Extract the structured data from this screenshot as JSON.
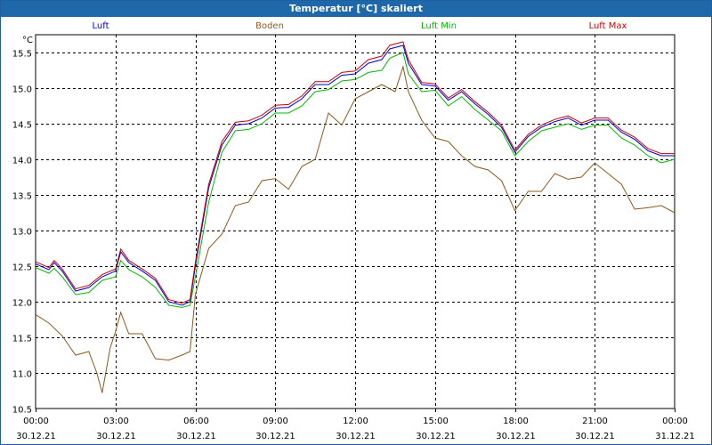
{
  "window": {
    "title": "Temperatur [°C] skaliert"
  },
  "chart_data": {
    "type": "line",
    "title": "Temperatur [°C] skaliert",
    "ylabel": "°C",
    "ylim": [
      10.5,
      15.75
    ],
    "yticks": [
      10.5,
      11.0,
      11.5,
      12.0,
      12.5,
      13.0,
      13.5,
      14.0,
      14.5,
      15.0,
      15.5
    ],
    "xlim": [
      0,
      24
    ],
    "xticks": [
      {
        "time": "00:00",
        "date": "30.12.21"
      },
      {
        "time": "03:00",
        "date": "30.12.21"
      },
      {
        "time": "06:00",
        "date": "30.12.21"
      },
      {
        "time": "09:00",
        "date": "30.12.21"
      },
      {
        "time": "12:00",
        "date": "30.12.21"
      },
      {
        "time": "15:00",
        "date": "30.12.21"
      },
      {
        "time": "18:00",
        "date": "30.12.21"
      },
      {
        "time": "21:00",
        "date": "30.12.21"
      },
      {
        "time": "00:00",
        "date": "31.12.21"
      }
    ],
    "grid": true,
    "legend_position": "top",
    "series": [
      {
        "name": "Luft",
        "color": "#0000cc",
        "x": [
          0,
          0.5,
          0.7,
          1,
          1.5,
          2,
          2.5,
          3,
          3.2,
          3.5,
          4,
          4.5,
          5,
          5.5,
          5.8,
          6,
          6.5,
          7,
          7.5,
          8,
          8.5,
          9,
          9.5,
          10,
          10.5,
          11,
          11.5,
          12,
          12.5,
          13,
          13.3,
          13.8,
          14,
          14.5,
          15,
          15.5,
          16,
          16.5,
          17,
          17.5,
          18,
          18.5,
          19,
          19.5,
          20,
          20.5,
          21,
          21.5,
          22,
          22.5,
          23,
          23.5,
          24
        ],
        "y": [
          12.53,
          12.45,
          12.55,
          12.43,
          12.15,
          12.2,
          12.35,
          12.43,
          12.7,
          12.55,
          12.43,
          12.3,
          12.0,
          11.95,
          12.0,
          12.5,
          13.6,
          14.2,
          14.48,
          14.5,
          14.58,
          14.72,
          14.73,
          14.85,
          15.05,
          15.05,
          15.18,
          15.2,
          15.35,
          15.4,
          15.55,
          15.6,
          15.35,
          15.05,
          15.03,
          14.83,
          14.95,
          14.78,
          14.63,
          14.45,
          14.1,
          14.32,
          14.45,
          14.53,
          14.58,
          14.48,
          14.55,
          14.55,
          14.38,
          14.28,
          14.12,
          14.05,
          14.05
        ]
      },
      {
        "name": "Boden",
        "color": "#8b5a1e",
        "x": [
          0,
          0.5,
          1,
          1.5,
          2,
          2.3,
          2.5,
          2.8,
          3,
          3.2,
          3.5,
          4,
          4.5,
          5,
          5.5,
          5.8,
          6,
          6.5,
          7,
          7.5,
          8,
          8.5,
          9,
          9.5,
          10,
          10.5,
          11,
          11.5,
          12,
          12.5,
          13,
          13.5,
          13.8,
          14,
          14.5,
          15,
          15.5,
          16,
          16.5,
          17,
          17.5,
          18,
          18.5,
          19,
          19.5,
          20,
          20.5,
          21,
          21.5,
          22,
          22.5,
          23,
          23.5,
          24
        ],
        "y": [
          11.82,
          11.7,
          11.52,
          11.25,
          11.3,
          11.0,
          10.72,
          11.35,
          11.58,
          11.85,
          11.55,
          11.55,
          11.2,
          11.18,
          11.25,
          11.3,
          12.1,
          12.75,
          12.95,
          13.35,
          13.4,
          13.7,
          13.73,
          13.58,
          13.9,
          14.0,
          14.65,
          14.48,
          14.85,
          14.95,
          15.05,
          14.95,
          15.3,
          14.95,
          14.55,
          14.3,
          14.25,
          14.05,
          13.9,
          13.85,
          13.7,
          13.28,
          13.55,
          13.55,
          13.8,
          13.72,
          13.75,
          13.95,
          13.8,
          13.65,
          13.3,
          13.32,
          13.35,
          13.25
        ]
      },
      {
        "name": "Luft Min",
        "color": "#00bb00",
        "x": [
          0,
          0.5,
          0.7,
          1,
          1.5,
          2,
          2.5,
          3,
          3.2,
          3.5,
          4,
          4.5,
          5,
          5.5,
          5.8,
          6,
          6.5,
          7,
          7.5,
          8,
          8.5,
          9,
          9.5,
          10,
          10.5,
          11,
          11.5,
          12,
          12.5,
          13,
          13.3,
          13.8,
          14,
          14.5,
          15,
          15.5,
          16,
          16.5,
          17,
          17.5,
          18,
          18.5,
          19,
          19.5,
          20,
          20.5,
          21,
          21.5,
          22,
          22.5,
          23,
          23.5,
          24
        ],
        "y": [
          12.48,
          12.4,
          12.47,
          12.35,
          12.1,
          12.13,
          12.3,
          12.35,
          12.58,
          12.45,
          12.35,
          12.2,
          11.95,
          11.92,
          11.95,
          12.35,
          13.4,
          14.1,
          14.4,
          14.42,
          14.5,
          14.65,
          14.65,
          14.75,
          14.95,
          14.98,
          15.1,
          15.12,
          15.22,
          15.25,
          15.42,
          15.5,
          15.2,
          14.95,
          14.97,
          14.75,
          14.88,
          14.7,
          14.55,
          14.4,
          14.05,
          14.25,
          14.4,
          14.45,
          14.5,
          14.42,
          14.48,
          14.48,
          14.3,
          14.2,
          14.05,
          13.95,
          14.0
        ]
      },
      {
        "name": "Luft Max",
        "color": "#cc0000",
        "x": [
          0,
          0.5,
          0.7,
          1,
          1.5,
          2,
          2.5,
          3,
          3.2,
          3.5,
          4,
          4.5,
          5,
          5.5,
          5.8,
          6,
          6.5,
          7,
          7.5,
          8,
          8.5,
          9,
          9.5,
          10,
          10.5,
          11,
          11.5,
          12,
          12.5,
          13,
          13.3,
          13.8,
          14,
          14.5,
          15,
          15.5,
          16,
          16.5,
          17,
          17.5,
          18,
          18.5,
          19,
          19.5,
          20,
          20.5,
          21,
          21.5,
          22,
          22.5,
          23,
          23.5,
          24
        ],
        "y": [
          12.56,
          12.48,
          12.58,
          12.46,
          12.18,
          12.23,
          12.38,
          12.46,
          12.74,
          12.58,
          12.46,
          12.33,
          12.03,
          11.98,
          12.03,
          12.55,
          13.65,
          14.25,
          14.52,
          14.54,
          14.62,
          14.76,
          14.77,
          14.89,
          15.09,
          15.09,
          15.22,
          15.24,
          15.4,
          15.45,
          15.6,
          15.65,
          15.4,
          15.08,
          15.06,
          14.86,
          14.98,
          14.81,
          14.66,
          14.48,
          14.13,
          14.35,
          14.48,
          14.56,
          14.61,
          14.51,
          14.58,
          14.58,
          14.41,
          14.31,
          14.15,
          14.08,
          14.08
        ]
      }
    ]
  }
}
